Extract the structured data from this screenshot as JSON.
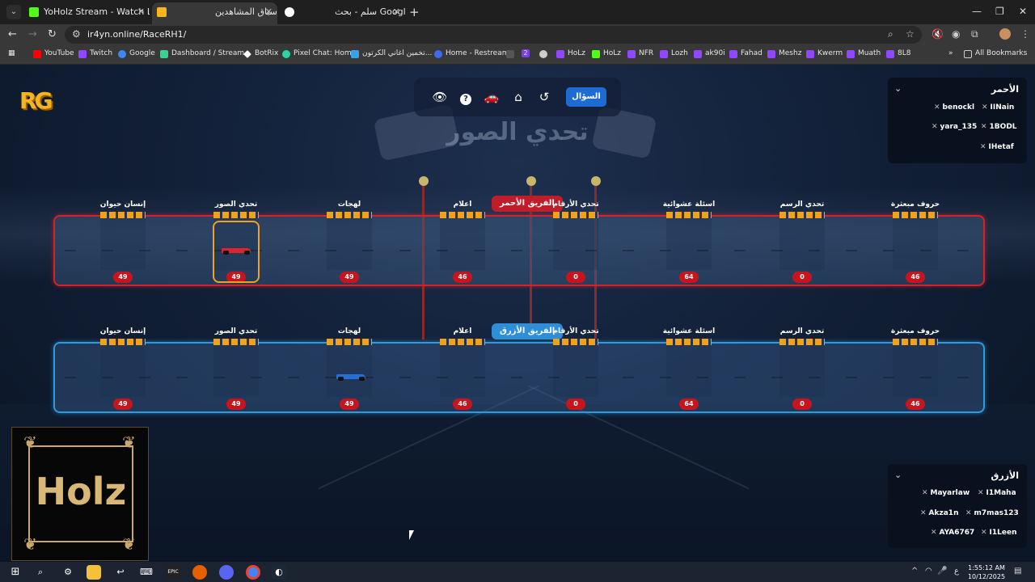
{
  "browser": {
    "tabs": [
      {
        "title": "YoHolz Stream - Watch Live on",
        "color": "#53fc18"
      },
      {
        "title": "سباق المشاهدين",
        "color": "#f5b51c"
      },
      {
        "title": "سلم - بحث Google",
        "color": "#4285f4"
      }
    ],
    "url": "ir4yn.online/RaceRH1/",
    "bookmarks": [
      {
        "label": "YouTube",
        "color": "#ff0000"
      },
      {
        "label": "Twitch",
        "color": "#9146ff"
      },
      {
        "label": "Google",
        "color": "#4285f4"
      },
      {
        "label": "Dashboard / Stream...",
        "color": "#3ecf8e"
      },
      {
        "label": "BotRix",
        "color": "#ffffff"
      },
      {
        "label": "Pixel Chat: Home",
        "color": "#2ad3a6"
      },
      {
        "label": "تخمين اغاني الكرتون...",
        "color": "#3aa0e8"
      },
      {
        "label": "Home - Restream",
        "color": "#3e6cf0"
      },
      {
        "label": "2",
        "color": "#7b3fe4"
      },
      {
        "label": "HoLz",
        "color": "#9146ff"
      },
      {
        "label": "HoLz",
        "color": "#53fc18"
      },
      {
        "label": "NFR",
        "color": "#9146ff"
      },
      {
        "label": "Lozh",
        "color": "#9146ff"
      },
      {
        "label": "ak90i",
        "color": "#9146ff"
      },
      {
        "label": "Fahad",
        "color": "#9146ff"
      },
      {
        "label": "Meshz",
        "color": "#9146ff"
      },
      {
        "label": "Kwerm",
        "color": "#9146ff"
      },
      {
        "label": "Muath",
        "color": "#9146ff"
      },
      {
        "label": "8L8",
        "color": "#9146ff"
      }
    ],
    "all_bookmarks": "All Bookmarks"
  },
  "game": {
    "logo": "RG",
    "question_button": "السؤال",
    "title": "تحدي الصور",
    "red_team_label": "الفريق الأحمر",
    "blue_team_label": "الفريق الأزرق",
    "stations": [
      "إنسان حيوان",
      "تحدي الصور",
      "لهجات",
      "اعلام",
      "تحدي الأرقام",
      "اسئلة عشوائية",
      "تحدي الرسم",
      "حروف مبعثرة"
    ],
    "scores": [
      "49",
      "49",
      "49",
      "46",
      "0",
      "64",
      "0",
      "46"
    ],
    "red_position_station": 1,
    "blue_position_station": 2,
    "red_roster": {
      "title": "الأحمر",
      "players": [
        "IINain",
        "benockl",
        "1BODL",
        "yara_135",
        "IHetaf"
      ]
    },
    "blue_roster": {
      "title": "الأزرق",
      "players": [
        "I1Maha",
        "Mayarlaw",
        "m7mas123",
        "Akza1n",
        "I1Leen",
        "AYA6767"
      ]
    },
    "webcam_name": "Holz"
  },
  "taskbar": {
    "time": "1:55:12 AM",
    "date": "10/12/2025",
    "lang": "ع"
  }
}
